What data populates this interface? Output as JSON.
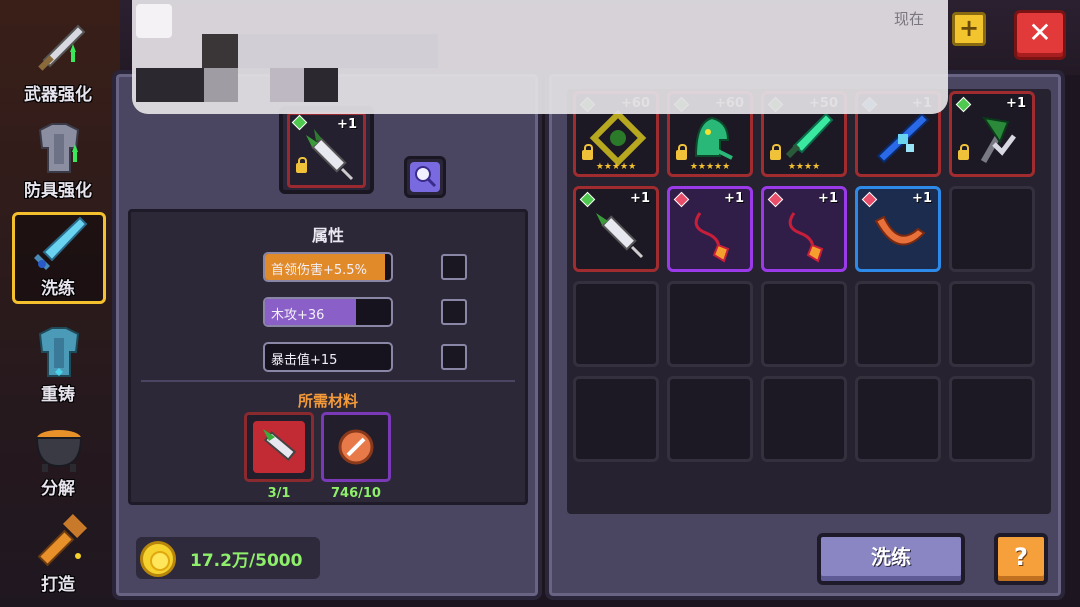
{
  "side_nav": {
    "items": [
      {
        "label": "武器强化"
      },
      {
        "label": "防具强化"
      },
      {
        "label": "洗练"
      },
      {
        "label": "重铸"
      },
      {
        "label": "分解"
      },
      {
        "label": "打造"
      }
    ],
    "active_index": 2
  },
  "notification": {
    "time": "现在"
  },
  "selected_item": {
    "level": "+1"
  },
  "attributes": {
    "title": "属性",
    "rows": [
      {
        "text": "首领伤害+5.5%",
        "fill": 0.95,
        "color": "#e08a2a",
        "checked": false
      },
      {
        "text": "木攻+36",
        "fill": 0.72,
        "color": "#8a60c8",
        "checked": false
      },
      {
        "text": "暴击值+15",
        "fill": 0.0,
        "color": "#6a6a8a",
        "checked": false
      }
    ]
  },
  "materials": {
    "title": "所需材料",
    "items": [
      {
        "count": "3/1"
      },
      {
        "count": "746/10"
      }
    ]
  },
  "currency": {
    "amount": "17.2万/5000"
  },
  "inventory": {
    "slots": [
      {
        "rarity": "red",
        "level": "+60",
        "gem": "#4ec84e",
        "locked": true,
        "stars": "★★★★★",
        "icon": "thorn-ring-icon"
      },
      {
        "rarity": "red",
        "level": "+60",
        "gem": "#4ec84e",
        "locked": true,
        "stars": "★★★★★",
        "icon": "snake-helm-icon"
      },
      {
        "rarity": "red",
        "level": "+50",
        "gem": "#4ec84e",
        "locked": true,
        "stars": "★★★★",
        "icon": "leaf-blade-icon"
      },
      {
        "rarity": "red",
        "level": "+1",
        "gem": "#4ad2e8",
        "locked": false,
        "stars": "",
        "icon": "ice-sword-icon"
      },
      {
        "rarity": "red",
        "level": "+1",
        "gem": "#4ec84e",
        "locked": true,
        "stars": "",
        "icon": "vine-axe-icon"
      },
      {
        "rarity": "red",
        "level": "+1",
        "gem": "#4ec84e",
        "locked": false,
        "stars": "",
        "icon": "syringe-icon"
      },
      {
        "rarity": "purple",
        "level": "+1",
        "gem": "#e84e6a",
        "locked": false,
        "stars": "",
        "icon": "fire-whip-icon"
      },
      {
        "rarity": "purple",
        "level": "+1",
        "gem": "#e84e6a",
        "locked": false,
        "stars": "",
        "icon": "fire-whip-icon"
      },
      {
        "rarity": "blue",
        "level": "+1",
        "gem": "#e84e6a",
        "locked": false,
        "stars": "",
        "icon": "boomerang-icon"
      }
    ],
    "total_slots": 20
  },
  "buttons": {
    "wash": "洗练",
    "help": "?",
    "plus": "+",
    "close": "✕"
  }
}
